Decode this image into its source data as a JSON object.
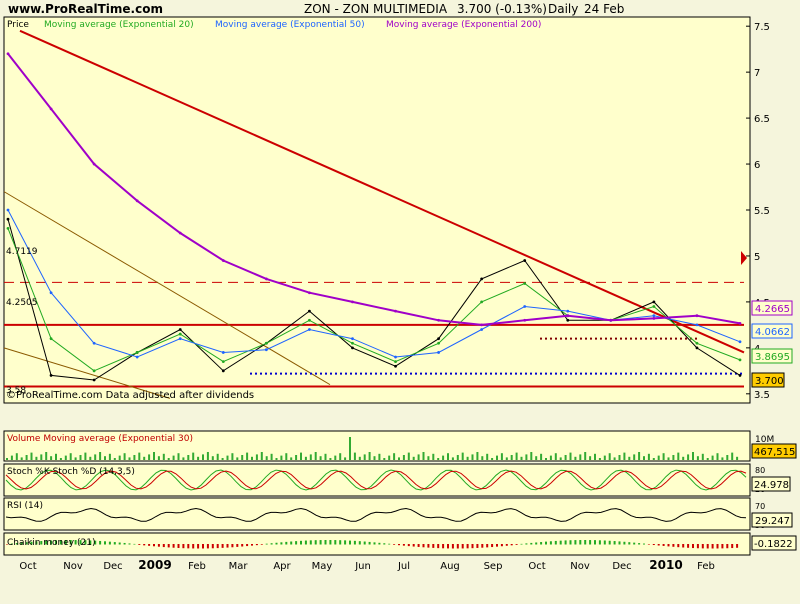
{
  "header": {
    "site": "www.ProRealTime.com",
    "title": "ZON - ZON MULTIMEDIA",
    "quote": "3.700 (-0.13%)",
    "period": "Daily",
    "date": "24 Feb"
  },
  "price_panel": {
    "legend": [
      {
        "label": "Price",
        "color": "#000000"
      },
      {
        "label": "Moving average (Exponential 20)",
        "color": "#22aa22"
      },
      {
        "label": "Moving average (Exponential 50)",
        "color": "#1e64ff"
      },
      {
        "label": "Moving average (Exponential 200)",
        "color": "#a000c8"
      }
    ],
    "footer": "©ProRealTime.com  Data adjusted after dividends",
    "left_levels": [
      "4.7119",
      "4.2505",
      "3.58"
    ],
    "right_badges": [
      {
        "label": "4.2665",
        "color": "#a000c8"
      },
      {
        "label": "4.0662",
        "color": "#1e64ff"
      },
      {
        "label": "3.8695",
        "color": "#22aa22"
      },
      {
        "label": "3.700",
        "color": "#000000"
      }
    ],
    "yaxis_ticks": [
      "7.5",
      "7",
      "6.5",
      "6",
      "5.5",
      "5",
      "4.5",
      "4",
      "3.5"
    ]
  },
  "volume_panel": {
    "title": "Volume  Moving average (Exponential 30)",
    "tick": "10M",
    "badge": "467,515"
  },
  "stoch_panel": {
    "title": "Stoch %K Stoch %D (14,3,5)",
    "ticks": [
      "80",
      "20"
    ],
    "badge": "24.978"
  },
  "rsi_panel": {
    "title": "RSI (14)",
    "ticks": [
      "70",
      "30"
    ],
    "badge": "29.247"
  },
  "chaikin_panel": {
    "title": "Chaikin money (21)",
    "badge": "-0.1822"
  },
  "xaxis": {
    "labels": [
      "Oct",
      "Nov",
      "Dec",
      "2009",
      "Feb",
      "Mar",
      "Apr",
      "May",
      "Jun",
      "Jul",
      "Aug",
      "Sep",
      "Oct",
      "Nov",
      "Dec",
      "2010",
      "Feb"
    ]
  },
  "chart_data": {
    "type": "line",
    "title": "ZON - ZON MULTIMEDIA",
    "ylim": [
      3.4,
      7.6
    ],
    "x": [
      "Oct 2008",
      "Nov 2008",
      "Dec 2008",
      "Jan 2009",
      "Feb 2009",
      "Mar 2009",
      "Apr 2009",
      "May 2009",
      "Jun 2009",
      "Jul 2009",
      "Aug 2009",
      "Sep 2009",
      "Oct 2009",
      "Nov 2009",
      "Dec 2009",
      "Jan 2010",
      "Feb 2010",
      "24 Feb 2010"
    ],
    "series": [
      {
        "name": "Price",
        "values": [
          5.4,
          3.7,
          3.65,
          3.95,
          4.2,
          3.75,
          4.05,
          4.4,
          4.0,
          3.8,
          4.1,
          4.75,
          4.95,
          4.3,
          4.3,
          4.5,
          4.0,
          3.7
        ]
      },
      {
        "name": "Moving average (Exponential 20)",
        "values": [
          5.3,
          4.1,
          3.75,
          3.95,
          4.15,
          3.85,
          4.05,
          4.3,
          4.05,
          3.85,
          4.05,
          4.5,
          4.7,
          4.35,
          4.3,
          4.45,
          4.05,
          3.8695
        ]
      },
      {
        "name": "Moving average (Exponential 50)",
        "values": [
          5.5,
          4.6,
          4.05,
          3.9,
          4.1,
          3.95,
          3.98,
          4.2,
          4.1,
          3.9,
          3.95,
          4.2,
          4.45,
          4.4,
          4.3,
          4.35,
          4.25,
          4.0662
        ]
      },
      {
        "name": "Moving average (Exponential 200)",
        "values": [
          7.2,
          6.6,
          6.0,
          5.6,
          5.25,
          4.95,
          4.75,
          4.6,
          4.5,
          4.4,
          4.3,
          4.25,
          4.3,
          4.35,
          4.3,
          4.32,
          4.35,
          4.2665
        ]
      }
    ],
    "levels": [
      4.7119,
      4.2505,
      3.58
    ],
    "last_values": {
      "price": 3.7,
      "volume": 467515,
      "stoch": 24.978,
      "rsi": 29.247,
      "chaikin": -0.1822
    }
  }
}
